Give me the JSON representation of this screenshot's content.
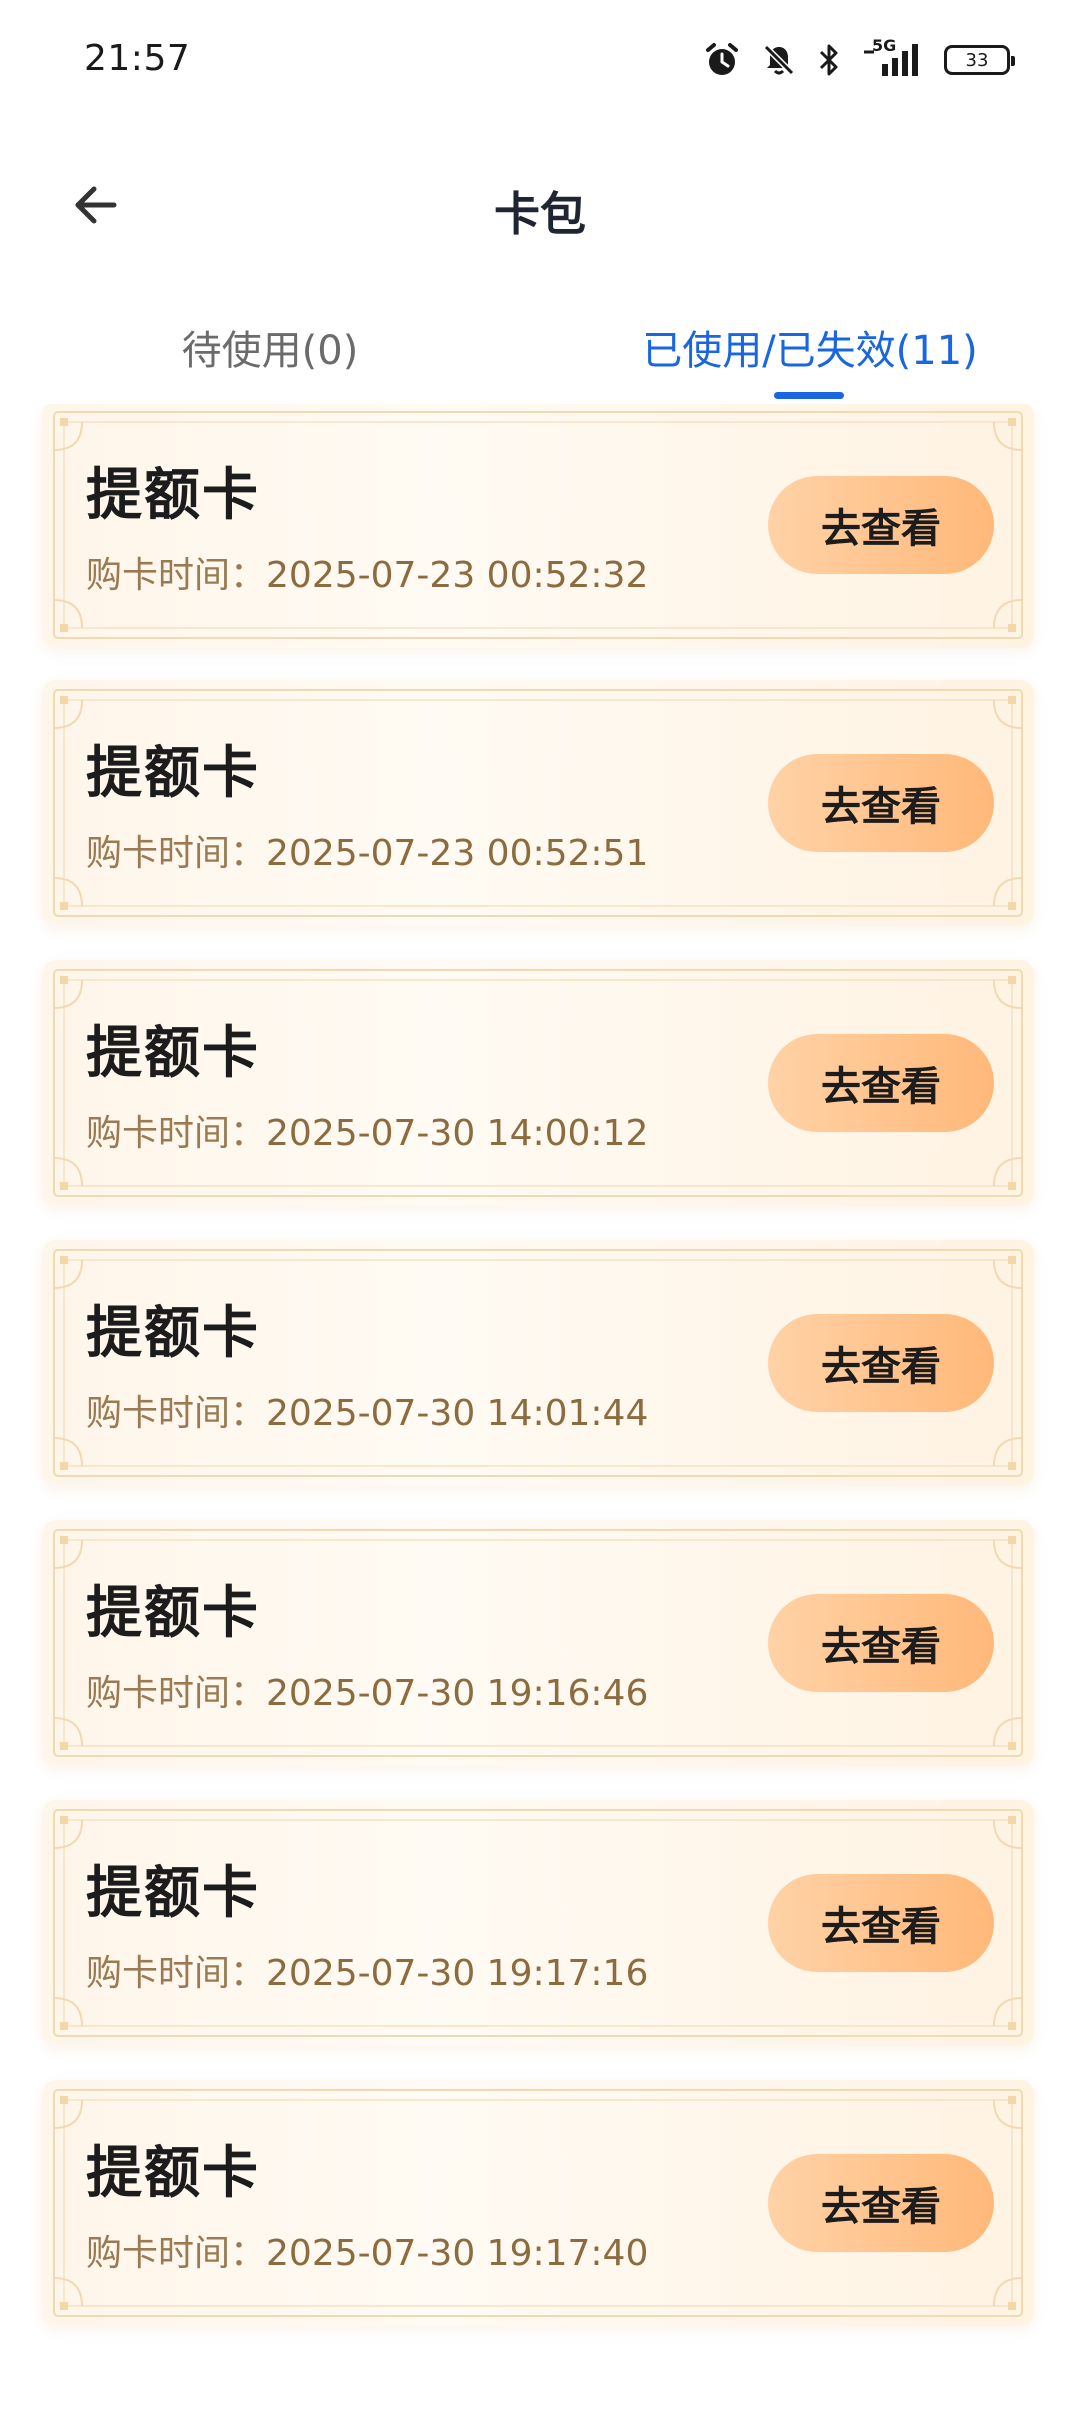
{
  "status_bar": {
    "time": "21:57",
    "network": "5G",
    "battery": "33",
    "icons": [
      "alarm-icon",
      "mute-bell-icon",
      "bluetooth-icon",
      "signal-icon",
      "battery-icon"
    ]
  },
  "header": {
    "title": "卡包",
    "back_icon": "arrow-left-icon"
  },
  "tabs": [
    {
      "label": "待使用(0)",
      "active": false
    },
    {
      "label": "已使用/已失效(11)",
      "active": true
    }
  ],
  "colors": {
    "accent": "#1a66e0",
    "button_start": "#ffd2a6",
    "button_end": "#ffb879",
    "card_bg": "#fff6ea",
    "time_text": "#8c6b3f"
  },
  "cards": [
    {
      "title": "提额卡",
      "time_label": "购卡时间：",
      "time": "2025-07-23 00:52:32",
      "button": "去查看"
    },
    {
      "title": "提额卡",
      "time_label": "购卡时间：",
      "time": "2025-07-23 00:52:51",
      "button": "去查看"
    },
    {
      "title": "提额卡",
      "time_label": "购卡时间：",
      "time": "2025-07-30 14:00:12",
      "button": "去查看"
    },
    {
      "title": "提额卡",
      "time_label": "购卡时间：",
      "time": "2025-07-30 14:01:44",
      "button": "去查看"
    },
    {
      "title": "提额卡",
      "time_label": "购卡时间：",
      "time": "2025-07-30 19:16:46",
      "button": "去查看"
    },
    {
      "title": "提额卡",
      "time_label": "购卡时间：",
      "time": "2025-07-30 19:17:16",
      "button": "去查看"
    },
    {
      "title": "提额卡",
      "time_label": "购卡时间：",
      "time": "2025-07-30 19:17:40",
      "button": "去查看"
    }
  ]
}
